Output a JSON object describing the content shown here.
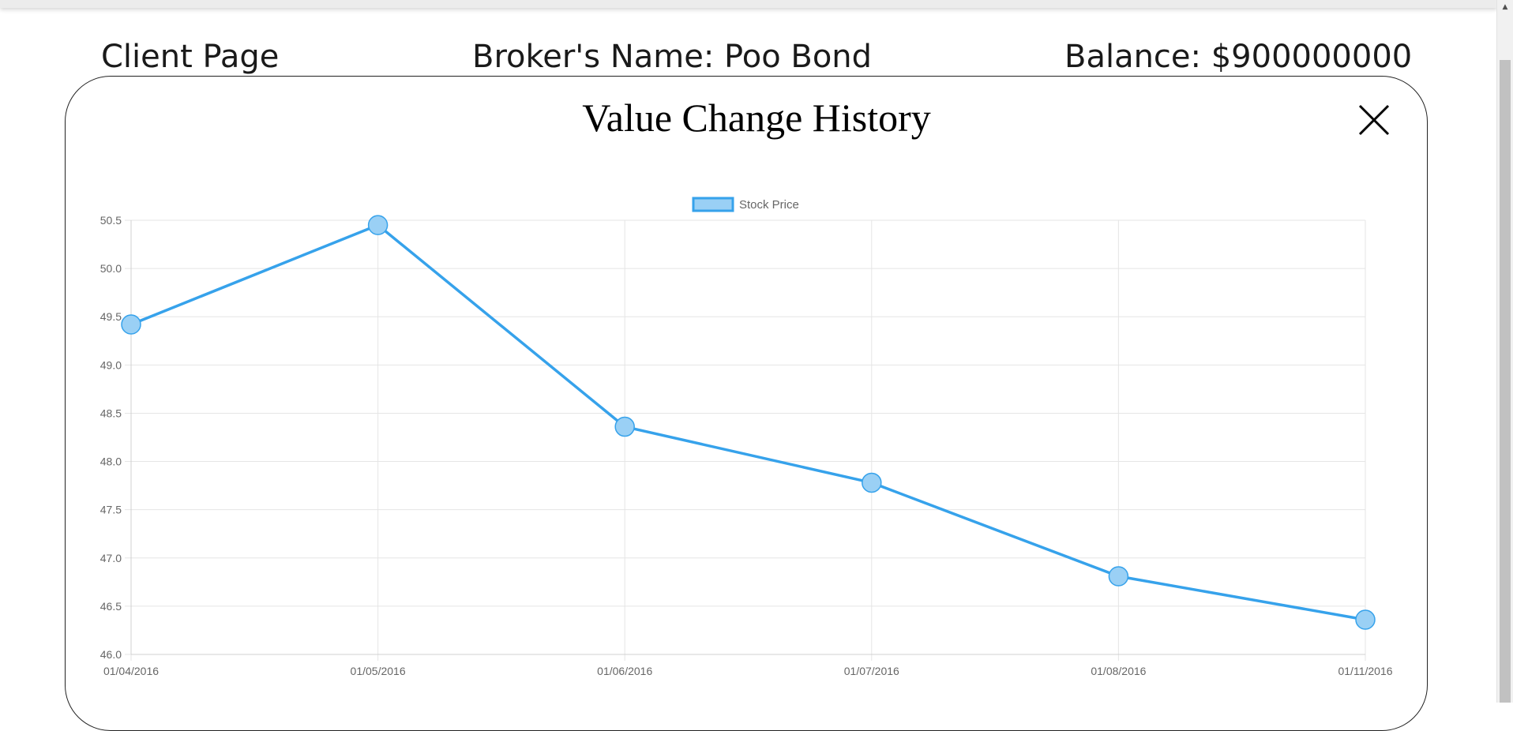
{
  "header": {
    "client_label": "Client Page",
    "broker_label": "Broker's Name: Poo Bond",
    "balance_label": "Balance: $900000000"
  },
  "modal": {
    "title": "Value Change History",
    "close_icon": "close-icon"
  },
  "colors": {
    "line": "#36a2eb",
    "point_fill": "#9ad0f5",
    "grid": "#e5e5e5",
    "tick_text": "#666666"
  },
  "chart_data": {
    "type": "line",
    "title": "",
    "xlabel": "",
    "ylabel": "",
    "categories": [
      "01/04/2016",
      "01/05/2016",
      "01/06/2016",
      "01/07/2016",
      "01/08/2016",
      "01/11/2016"
    ],
    "series": [
      {
        "name": "Stock Price",
        "values": [
          49.42,
          50.45,
          48.36,
          47.78,
          46.81,
          46.36
        ]
      }
    ],
    "ylim": [
      46.0,
      50.5
    ],
    "yticks": [
      "50.5",
      "50.0",
      "49.5",
      "49.0",
      "48.5",
      "48.0",
      "47.5",
      "47.0",
      "46.5",
      "46.0"
    ],
    "grid": true,
    "legend": "top-center"
  }
}
